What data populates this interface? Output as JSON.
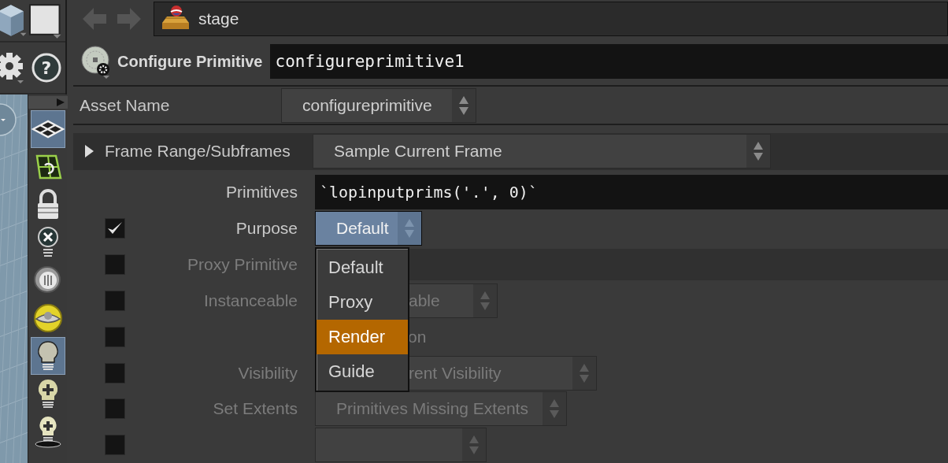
{
  "help_button": {
    "glyph": "?"
  },
  "nav": {
    "path": "stage"
  },
  "node": {
    "type_label": "Configure Primitive",
    "name": "configureprimitive1"
  },
  "asset_name": {
    "label": "Asset Name",
    "value": "configureprimitive"
  },
  "folder": {
    "label": "Frame Range/Subframes",
    "expanded": false,
    "value": "Sample Current Frame"
  },
  "parameters": [
    {
      "kind": "text",
      "label": "Primitives",
      "value": "`lopinputprims('.', 0)`",
      "disabled": false
    },
    {
      "kind": "menu",
      "label": "Purpose",
      "checked": true,
      "disabled": false,
      "value": "Default",
      "open": true
    },
    {
      "kind": "text",
      "label": "Proxy Primitive",
      "checked": false,
      "disabled": true
    },
    {
      "kind": "menu",
      "label": "Instanceable",
      "checked": false,
      "disabled": true,
      "value": "able",
      "covered": true
    },
    {
      "kind": "toggle",
      "checked": false,
      "disabled": true,
      "text": "on",
      "covered": true
    },
    {
      "kind": "menu",
      "label": "Visibility",
      "checked": false,
      "disabled": true,
      "value": "rent Visibility",
      "covered": true
    },
    {
      "kind": "menu",
      "label": "Set Extents",
      "checked": false,
      "disabled": true,
      "value": "Primitives Missing Extents"
    },
    {
      "kind": "menu",
      "checked": false,
      "disabled": true
    }
  ],
  "popup_menu": {
    "items": [
      {
        "label": "Default",
        "selected": false
      },
      {
        "label": "Proxy",
        "selected": false
      },
      {
        "label": "Render",
        "selected": true
      },
      {
        "label": "Guide",
        "selected": false
      }
    ]
  }
}
